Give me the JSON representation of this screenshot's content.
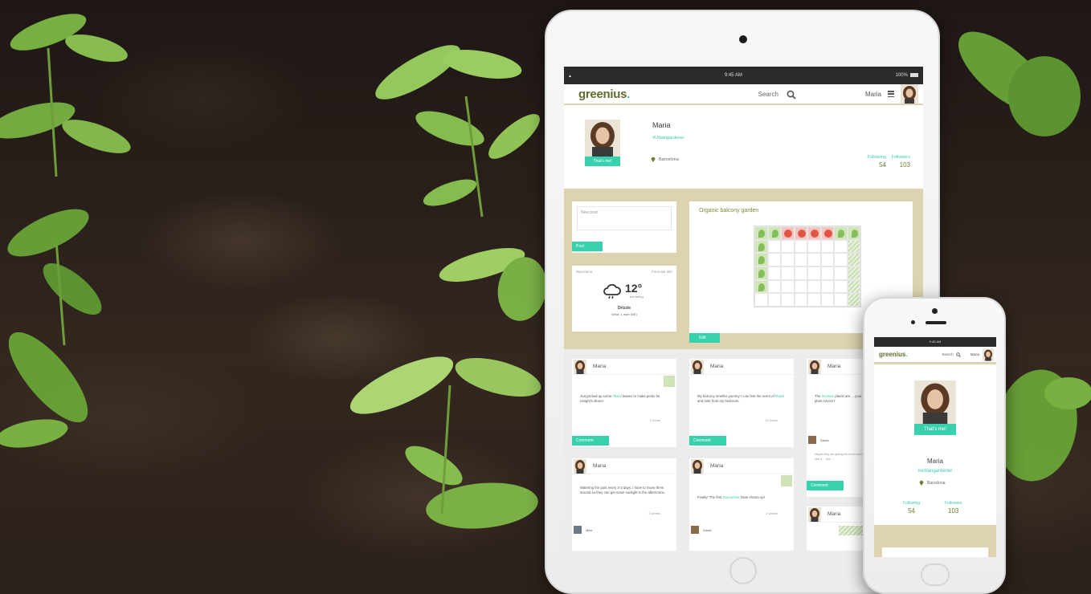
{
  "ipad": {
    "status": {
      "time": "9:45 AM",
      "battery": "100%"
    },
    "appbar": {
      "logo": "greenius",
      "logo_dot": ".",
      "search_label": "Search",
      "user_name": "Maria"
    },
    "profile": {
      "name": "Maria",
      "tag": "#Urbangardener",
      "button": "That's me!",
      "location": "Barcelona",
      "following_label": "Following",
      "following_count": "54",
      "followers_label": "Followers",
      "followers_count": "103"
    },
    "new_post": {
      "placeholder": "New post",
      "button": "Post"
    },
    "weather": {
      "city": "Barcelona",
      "forecast_link": "Forecast info",
      "temperature": "12°",
      "desc": "feel feeling",
      "condition": "Drizzle",
      "wind": "Wind: 1 mph (NE)"
    },
    "garden": {
      "title": "Organic balcony garden",
      "edit": "Edit"
    },
    "feed": [
      {
        "name": "Maria",
        "text_pre": "Just picked up some ",
        "highlight": "#basil",
        "text_post": " leaves to make pesto for tonight's dinner.",
        "time": "2 hours",
        "button": "Comment"
      },
      {
        "name": "Maria",
        "text_pre": "My balcony smelles yummy! I can feel the scent of ",
        "highlight": "#basil",
        "text_post": " and mint from my bedroom.",
        "time": "10 hours",
        "button": "Comment"
      },
      {
        "name": "Maria",
        "text_pre": "The ",
        "highlight": "#tomato",
        "text_post": " plants are ... your ... plant Advice?",
        "time": "",
        "button": "Comment",
        "reply_name": "Sarah",
        "reply_text": "Maybe they are getting too much sun? ... not with a ... and ..."
      },
      {
        "name": "Maria",
        "text_pre": "Watering the pots every 2-3 days. I have to move them around so they can get some sunlight in the afternoons.",
        "highlight": "",
        "text_post": "",
        "time": "2 weeks",
        "reply_name": "Mike"
      },
      {
        "name": "Maria",
        "text_pre": "Finally! The first ",
        "highlight": "#cucumber",
        "text_post": " have shown up!",
        "time": "2 weeks",
        "reply_name": "Sarah"
      },
      {
        "name": "Maria"
      }
    ]
  },
  "iphone": {
    "status": {
      "time": "9:45 AM"
    },
    "appbar": {
      "logo": "greenius",
      "logo_dot": ".",
      "search_label": "Search",
      "user_name": "Maria"
    },
    "profile": {
      "button": "That's me!",
      "name": "Maria",
      "tag": "#urbangardener",
      "location": "Barcelona",
      "following_label": "Following",
      "following_count": "54",
      "followers_label": "Followers",
      "followers_count": "103"
    }
  },
  "colors": {
    "accent": "#38d1ae",
    "brand_olive": "#5f6a2c",
    "panel_beige": "#ddd3ae"
  }
}
